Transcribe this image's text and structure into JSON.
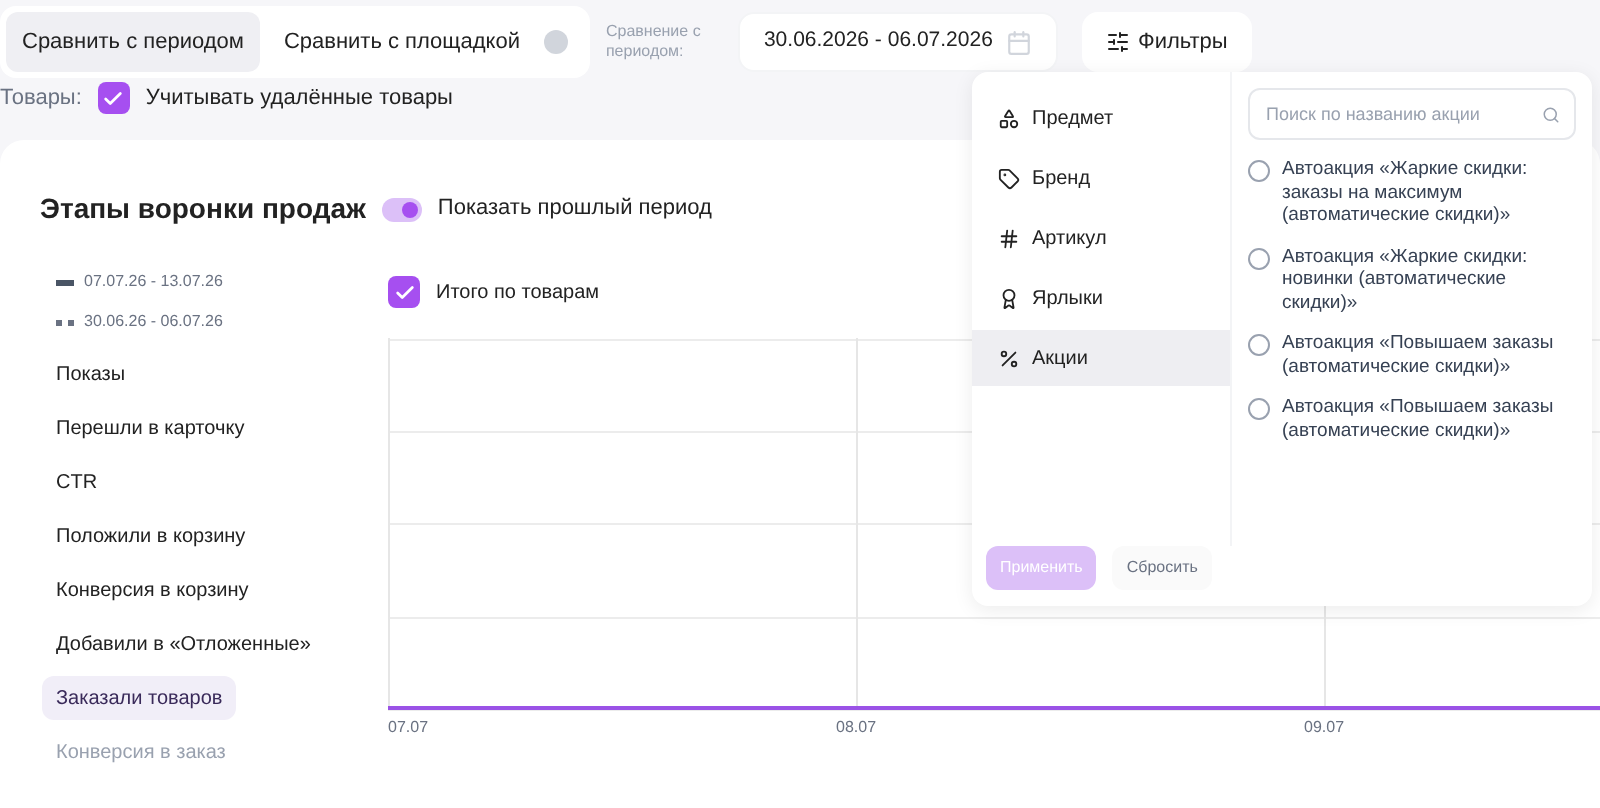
{
  "compare_tabs": [
    {
      "label": "Сравнить с периодом",
      "selected": true
    },
    {
      "label": "Сравнить с площадкой",
      "selected": false
    }
  ],
  "platform_switch": {
    "on": false
  },
  "compare_label": "Сравнение с периодом:",
  "date_range": {
    "value": "30.06.2026 - 06.07.2026"
  },
  "filters_button": "Фильтры",
  "products": {
    "label": "Товары:",
    "option": "Учитывать удалённые товары",
    "checked": true
  },
  "funnel": {
    "title": "Этапы воронки продаж",
    "show_past": {
      "label": "Показать прошлый период",
      "on": true
    },
    "legend": [
      {
        "kind": "solid",
        "label": "07.07.26 - 13.07.26"
      },
      {
        "kind": "dashed",
        "label": "30.06.26 - 06.07.26"
      }
    ],
    "total": {
      "label": "Итого по товарам",
      "checked": true
    },
    "metrics": [
      {
        "label": "Показы",
        "selected": false
      },
      {
        "label": "Перешли в карточку",
        "selected": false
      },
      {
        "label": "CTR",
        "selected": false
      },
      {
        "label": "Положили в корзину",
        "selected": false
      },
      {
        "label": "Конверсия в корзину",
        "selected": false
      },
      {
        "label": "Добавили в «Отложенные»",
        "selected": false
      },
      {
        "label": "Заказали товаров",
        "selected": true
      },
      {
        "label": "Конверсия в заказ",
        "selected": false
      }
    ],
    "x_labels": [
      "07.07",
      "08.07",
      "09.07"
    ]
  },
  "filter_popup": {
    "menu": [
      {
        "kind": "grid",
        "label": "Предмет",
        "selected": false
      },
      {
        "kind": "tag",
        "label": "Бренд",
        "selected": false
      },
      {
        "kind": "hash",
        "label": "Артикул",
        "selected": false
      },
      {
        "kind": "label",
        "label": "Ярлыки",
        "selected": false
      },
      {
        "kind": "percent",
        "label": "Акции",
        "selected": true
      }
    ],
    "search": {
      "placeholder": "Поиск по названию акции"
    },
    "options": [
      {
        "label": "Автоакция «Жаркие скидки: заказы на максимум (автоматические скидки)»",
        "selected": false
      },
      {
        "label": "Автоакция «Жаркие скидки: новинки (автоматические скидки)»",
        "selected": false
      },
      {
        "label": "Автоакция «Повышаем заказы (автоматические скидки)»",
        "selected": false
      },
      {
        "label": "Автоакция «Повышаем заказы (автоматические скидки)»",
        "selected": false
      }
    ],
    "apply": {
      "label": "Применить",
      "disabled": true
    },
    "reset": {
      "label": "Сбросить",
      "disabled": true
    }
  }
}
